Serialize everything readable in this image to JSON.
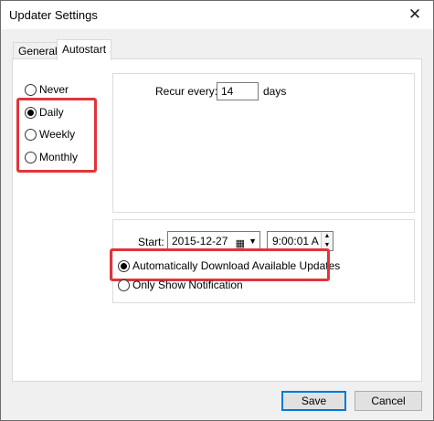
{
  "window": {
    "title": "Updater Settings"
  },
  "tabs": [
    {
      "label": "General"
    },
    {
      "label": "Autostart"
    }
  ],
  "frequency": {
    "options": [
      {
        "label": "Never",
        "checked": false
      },
      {
        "label": "Daily",
        "checked": true
      },
      {
        "label": "Weekly",
        "checked": false
      },
      {
        "label": "Monthly",
        "checked": false
      }
    ]
  },
  "recur": {
    "label": "Recur every:",
    "value": "14",
    "unit": "days"
  },
  "start": {
    "label": "Start:",
    "date": "2015-12-27",
    "time": "9:00:01 A"
  },
  "action": {
    "options": [
      {
        "label": "Automatically Download Available Updates",
        "checked": true
      },
      {
        "label": "Only Show Notification",
        "checked": false
      }
    ]
  },
  "buttons": {
    "save": "Save",
    "cancel": "Cancel"
  },
  "colors": {
    "highlight": "#e0353b",
    "accent": "#0078d7"
  }
}
